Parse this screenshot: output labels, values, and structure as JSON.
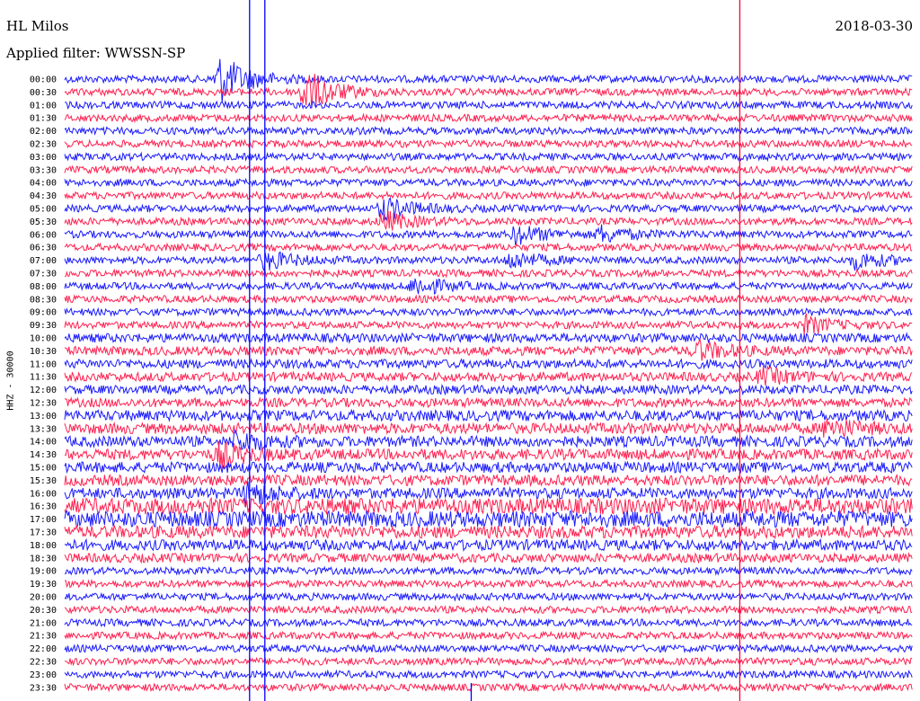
{
  "header": {
    "station": "HL Milos",
    "date": "2018-03-30",
    "filter_text": "Applied filter: WWSSN-SP"
  },
  "channel_label": "HHZ - 30000",
  "colors": {
    "trace_a": "#1a1aff",
    "trace_b": "#ff2050",
    "marker_blue": "#0000ff",
    "marker_red": "#ff0033"
  },
  "chart_data": {
    "type": "line",
    "title": "HL Milos",
    "subtitle": "Applied filter: WWSSN-SP",
    "ylabel": "HHZ - 30000",
    "xlabel": "",
    "categories": [
      "00:00",
      "00:30",
      "01:00",
      "01:30",
      "02:00",
      "02:30",
      "03:00",
      "03:30",
      "04:00",
      "04:30",
      "05:00",
      "05:30",
      "06:00",
      "06:30",
      "07:00",
      "07:30",
      "08:00",
      "08:30",
      "09:00",
      "09:30",
      "10:00",
      "10:30",
      "11:00",
      "11:30",
      "12:00",
      "12:30",
      "13:00",
      "13:30",
      "14:00",
      "14:30",
      "15:00",
      "15:30",
      "16:00",
      "16:30",
      "17:00",
      "17:30",
      "18:00",
      "18:30",
      "19:00",
      "19:30",
      "20:00",
      "20:30",
      "21:00",
      "21:30",
      "22:00",
      "22:30",
      "23:00",
      "23:30"
    ],
    "series": [
      {
        "name": "",
        "color": "#1a1aff",
        "description": "trace rows starting at 00:00, alternating every second row"
      },
      {
        "name": "",
        "color": "#ff2050",
        "description": "trace rows starting at 00:30, alternating every second row"
      }
    ],
    "base_amplitude": [
      4,
      4,
      4,
      4,
      4,
      4,
      4,
      4,
      4,
      4,
      4,
      4,
      4,
      4,
      4,
      4,
      4,
      4,
      4,
      4,
      5,
      5,
      5,
      5,
      5,
      5,
      6,
      6,
      6,
      6,
      6,
      6,
      6,
      9,
      9,
      7,
      6,
      5,
      4,
      4,
      4,
      4,
      4,
      4,
      4,
      4,
      4,
      4
    ],
    "events": [
      {
        "row": 0,
        "minute": 5.5,
        "amp": 26
      },
      {
        "row": 1,
        "minute": 8.5,
        "amp": 24
      },
      {
        "row": 10,
        "minute": 11.3,
        "amp": 12
      },
      {
        "row": 11,
        "minute": 11.3,
        "amp": 10
      },
      {
        "row": 12,
        "minute": 16.0,
        "amp": 10
      },
      {
        "row": 12,
        "minute": 19.0,
        "amp": 8
      },
      {
        "row": 14,
        "minute": 7.1,
        "amp": 10
      },
      {
        "row": 14,
        "minute": 15.8,
        "amp": 9
      },
      {
        "row": 14,
        "minute": 28.0,
        "amp": 9
      },
      {
        "row": 16,
        "minute": 12.4,
        "amp": 10
      },
      {
        "row": 19,
        "minute": 26.2,
        "amp": 9
      },
      {
        "row": 21,
        "minute": 22.4,
        "amp": 10
      },
      {
        "row": 23,
        "minute": 24.7,
        "amp": 8
      },
      {
        "row": 27,
        "minute": 27.0,
        "amp": 10
      },
      {
        "row": 28,
        "minute": 6.1,
        "amp": 10
      },
      {
        "row": 29,
        "minute": 5.5,
        "amp": 12
      },
      {
        "row": 32,
        "minute": 6.5,
        "amp": 12
      }
    ],
    "markers": [
      {
        "minute": 6.54,
        "color": "#0000ff",
        "extent": "full"
      },
      {
        "minute": 7.08,
        "color": "#0000ff",
        "extent": "full"
      },
      {
        "minute": 23.88,
        "color": "#ff0033",
        "extent": "full"
      },
      {
        "minute": 14.38,
        "color": "#0000ff",
        "extent": "bottom"
      }
    ],
    "xlim": [
      0,
      30
    ],
    "grid": false
  }
}
